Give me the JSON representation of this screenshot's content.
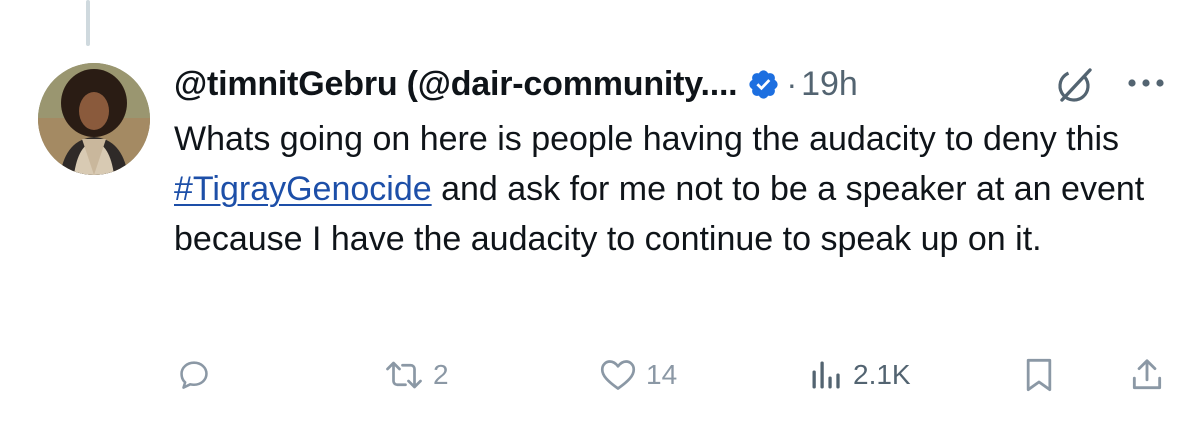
{
  "tweet": {
    "display_name": "@timnitGebru (@dair-community....",
    "separator": "·",
    "time": "19h",
    "text_before": "Whats going on here is people having the audacity to deny this ",
    "hashtag": "#TigrayGenocide",
    "text_after": " and ask for me not to be a speaker at an event because I have the audacity to continue to speak up on it."
  },
  "actions": {
    "retweet_count": "2",
    "like_count": "14",
    "view_count": "2.1K"
  },
  "colors": {
    "text": "#0f1419",
    "muted": "#536471",
    "icon": "#8b98a5",
    "verified": "#1d6fe0",
    "hashtag": "#1d4fa8"
  },
  "icons": [
    "avatar",
    "verified-badge-icon",
    "grok-icon",
    "more-icon",
    "reply-icon",
    "retweet-icon",
    "like-icon",
    "views-icon",
    "bookmark-icon",
    "share-icon"
  ]
}
